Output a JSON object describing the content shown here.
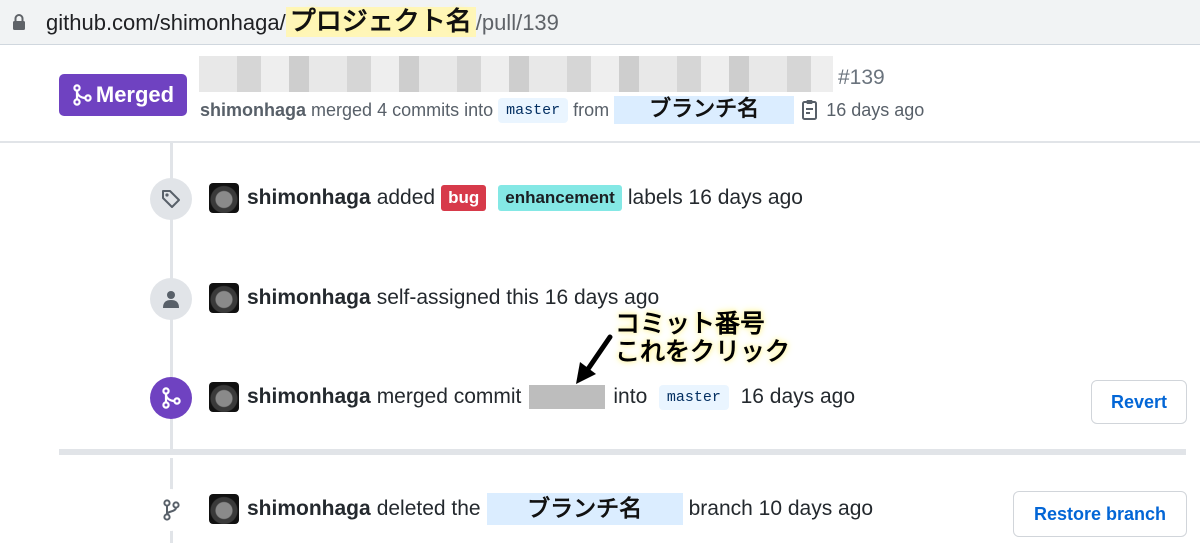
{
  "browser": {
    "url_prefix": "github.com/shimonhaga/",
    "url_project_placeholder": "プロジェクト名",
    "url_suffix": "/pull/139"
  },
  "pr": {
    "status": "Merged",
    "number": "#139",
    "author": "shimonhaga",
    "merged_text": "merged 4 commits into",
    "base_branch": "master",
    "from_text": "from",
    "head_branch_placeholder": "ブランチ名",
    "time": "16 days ago"
  },
  "timeline": [
    {
      "user": "shimonhaga",
      "action": "added",
      "labels": [
        "bug",
        "enhancement"
      ],
      "suffix": "labels 16 days ago"
    },
    {
      "user": "shimonhaga",
      "action": "self-assigned this 16 days ago"
    },
    {
      "user": "shimonhaga",
      "action": "merged commit",
      "into_text": "into",
      "branch": "master",
      "time": "16 days ago",
      "button": "Revert"
    },
    {
      "user": "shimonhaga",
      "action": "deleted the",
      "branch_placeholder": "ブランチ名",
      "suffix": "branch 10 days ago",
      "button": "Restore branch"
    }
  ],
  "annotation": {
    "line1": "コミット番号",
    "line2": "これをクリック"
  },
  "colors": {
    "merged_purple": "#6f42c1",
    "bug_label": "#d73a4a",
    "enhancement_label": "#84e8e5",
    "link_blue": "#0366d6"
  }
}
